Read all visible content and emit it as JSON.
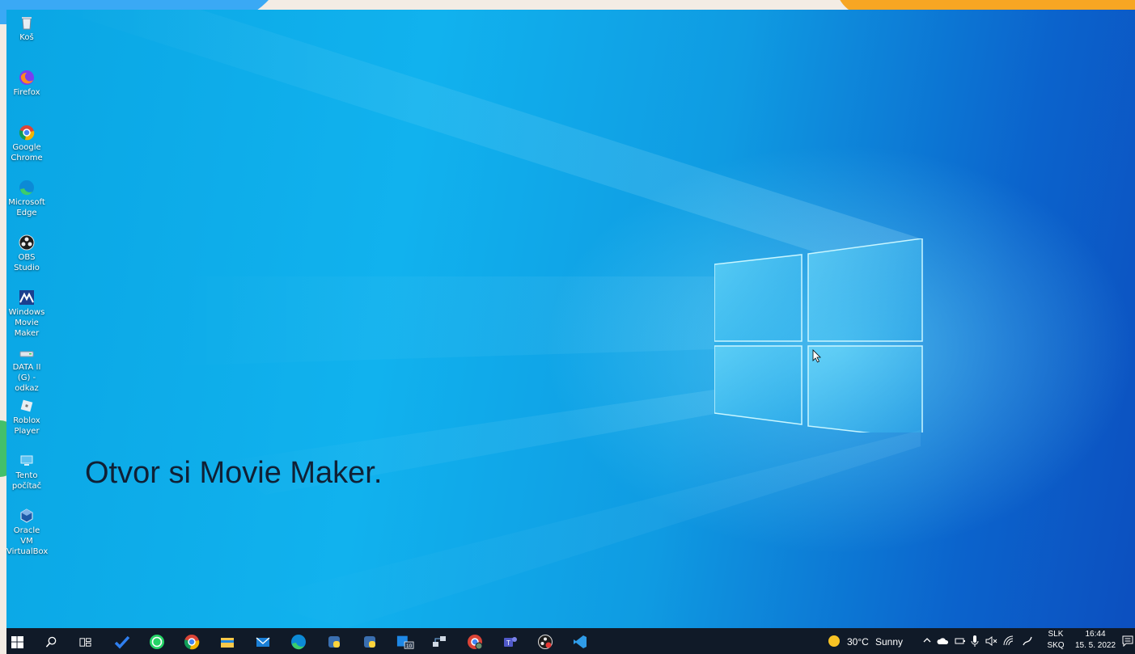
{
  "desktop_icons": [
    {
      "label": "Koš",
      "icon": "recycle-bin-icon"
    },
    {
      "label": "Firefox",
      "icon": "firefox-icon"
    },
    {
      "label": "Google Chrome",
      "icon": "chrome-icon"
    },
    {
      "label": "Microsoft Edge",
      "icon": "edge-icon"
    },
    {
      "label": "OBS Studio",
      "icon": "obs-icon"
    },
    {
      "label": "Windows Movie Maker",
      "icon": "movie-maker-icon"
    },
    {
      "label": "DATA II (G) - odkaz",
      "icon": "drive-shortcut-icon"
    },
    {
      "label": "Roblox Player",
      "icon": "roblox-icon"
    },
    {
      "label": "Tento počítač",
      "icon": "this-pc-icon"
    },
    {
      "label": "Oracle VM VirtualBox",
      "icon": "virtualbox-icon"
    }
  ],
  "caption": "Otvor si Movie Maker.",
  "taskbar": {
    "icons": [
      "start-icon",
      "search-icon",
      "task-view-icon",
      "todo-icon",
      "whatsapp-icon",
      "chrome-icon",
      "file-explorer-icon",
      "mail-icon",
      "edge-icon",
      "python-icon",
      "python-icon",
      "app-badge-icon",
      "network-app-icon",
      "chrome-profile-icon",
      "teams-icon",
      "obs-icon",
      "vscode-icon"
    ],
    "badge": "10",
    "weather": {
      "temp": "30°C",
      "condition": "Sunny",
      "icon": "sun-icon"
    },
    "lang_top": "SLK",
    "lang_bottom": "SKQ",
    "time": "16:44",
    "date": "15. 5. 2022",
    "notification_icon": "notification-icon"
  },
  "colors": {
    "taskbar": "#101a28",
    "wallpaper_light": "#11b2ee",
    "wallpaper_dark": "#0c4fbf",
    "caption": "#102035"
  }
}
